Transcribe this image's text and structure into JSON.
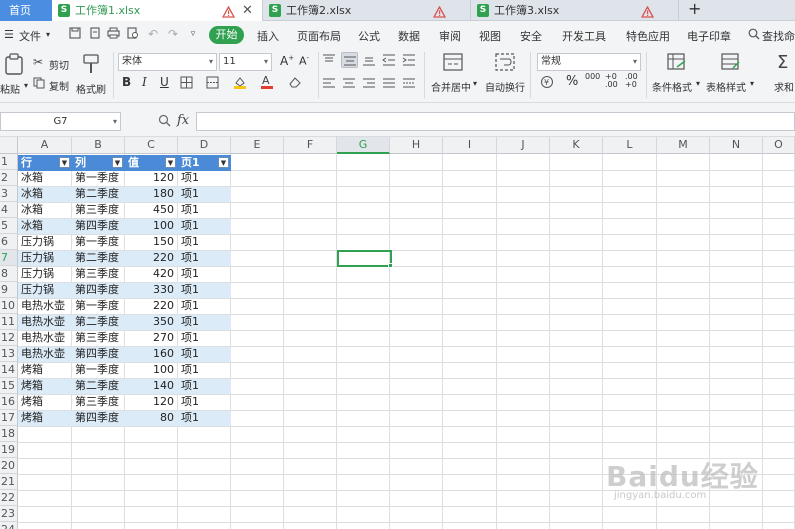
{
  "tabs": {
    "home": "首页",
    "files": [
      {
        "name": "工作簿1.xlsx",
        "active": true
      },
      {
        "name": "工作簿2.xlsx",
        "active": false
      },
      {
        "name": "工作簿3.xlsx",
        "active": false
      }
    ],
    "add": "+"
  },
  "menu": {
    "file": "文件",
    "items": [
      "开始",
      "插入",
      "页面布局",
      "公式",
      "数据",
      "审阅",
      "视图",
      "安全",
      "开发工具",
      "特色应用",
      "电子印章"
    ],
    "search": "查找命令"
  },
  "ribbon": {
    "paste": "粘贴",
    "cut": "剪切",
    "copy": "复制",
    "format_painter": "格式刷",
    "font_name": "宋体",
    "font_size": "11",
    "bold": "B",
    "italic": "I",
    "underline": "U",
    "merge_center": "合并居中",
    "wrap_text": "自动换行",
    "number_format": "常规",
    "conditional_format": "条件格式",
    "table_style": "表格样式",
    "sum": "求和"
  },
  "formula_bar": {
    "name_box": "G7",
    "fx": "fx",
    "formula": ""
  },
  "columns": [
    "A",
    "B",
    "C",
    "D",
    "E",
    "F",
    "G",
    "H",
    "I",
    "J",
    "K",
    "L",
    "M",
    "N",
    "O"
  ],
  "selected_column": "G",
  "rows": [
    "1",
    "2",
    "3",
    "4",
    "5",
    "6",
    "7",
    "8",
    "9",
    "10",
    "11",
    "12",
    "13",
    "14",
    "15",
    "16",
    "17",
    "18",
    "19",
    "20",
    "21",
    "22",
    "23",
    "24"
  ],
  "table": {
    "headers": [
      "行",
      "列",
      "值",
      "页1"
    ],
    "rows": [
      [
        "冰箱",
        "第一季度",
        "120",
        "项1"
      ],
      [
        "冰箱",
        "第二季度",
        "180",
        "项1"
      ],
      [
        "冰箱",
        "第三季度",
        "450",
        "项1"
      ],
      [
        "冰箱",
        "第四季度",
        "100",
        "项1"
      ],
      [
        "压力锅",
        "第一季度",
        "150",
        "项1"
      ],
      [
        "压力锅",
        "第二季度",
        "220",
        "项1"
      ],
      [
        "压力锅",
        "第三季度",
        "420",
        "项1"
      ],
      [
        "压力锅",
        "第四季度",
        "330",
        "项1"
      ],
      [
        "电热水壶",
        "第一季度",
        "220",
        "项1"
      ],
      [
        "电热水壶",
        "第二季度",
        "350",
        "项1"
      ],
      [
        "电热水壶",
        "第三季度",
        "270",
        "项1"
      ],
      [
        "电热水壶",
        "第四季度",
        "160",
        "项1"
      ],
      [
        "烤箱",
        "第一季度",
        "100",
        "项1"
      ],
      [
        "烤箱",
        "第二季度",
        "140",
        "项1"
      ],
      [
        "烤箱",
        "第三季度",
        "120",
        "项1"
      ],
      [
        "烤箱",
        "第四季度",
        "80",
        "项1"
      ]
    ]
  },
  "watermark": {
    "brand": "Baidu经验",
    "url": "jingyan.baidu.com"
  },
  "colors": {
    "accent_green": "#2fa150",
    "table_header_blue": "#4a8ad6",
    "band_blue": "#dcebf8"
  }
}
